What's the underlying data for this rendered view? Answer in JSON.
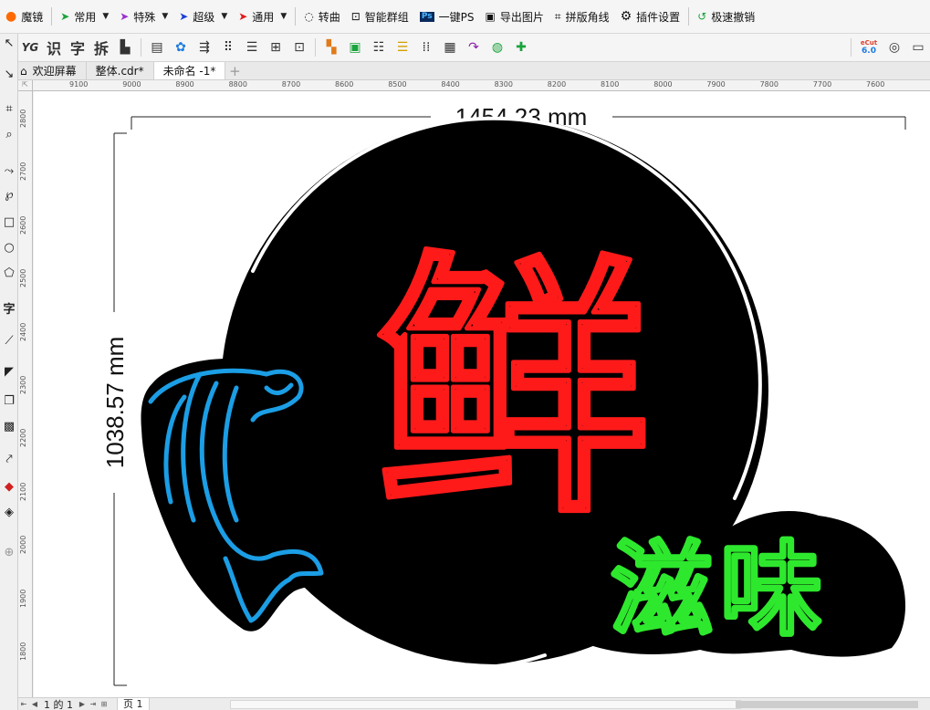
{
  "menubar": {
    "items": [
      {
        "label": "魔镜",
        "icon": "mojing-logo-icon",
        "dropdown": false
      },
      {
        "label": "常用",
        "icon": "green-arrow-icon",
        "dropdown": true
      },
      {
        "label": "特殊",
        "icon": "purple-arrow-icon",
        "dropdown": true
      },
      {
        "label": "超级",
        "icon": "blue-arrow-icon",
        "dropdown": true
      },
      {
        "label": "通用",
        "icon": "red-arrow-icon",
        "dropdown": true
      },
      {
        "label": "转曲",
        "icon": "convert-curve-icon",
        "dropdown": false
      },
      {
        "label": "智能群组",
        "icon": "smart-group-icon",
        "dropdown": false
      },
      {
        "label": "一键PS",
        "icon": "ps-icon",
        "dropdown": false
      },
      {
        "label": "导出图片",
        "icon": "image-export-icon",
        "dropdown": false
      },
      {
        "label": "拼版角线",
        "icon": "crop-marks-icon",
        "dropdown": false
      },
      {
        "label": "插件设置",
        "icon": "gear-icon",
        "dropdown": false
      },
      {
        "label": "极速撤销",
        "icon": "undo-icon",
        "dropdown": false
      }
    ]
  },
  "toolbar": {
    "text_tools": [
      "YG",
      "识",
      "字",
      "拆"
    ],
    "badge": "6.0"
  },
  "tabs": [
    {
      "label": "欢迎屏幕",
      "active": false
    },
    {
      "label": "整体.cdr*",
      "active": false
    },
    {
      "label": "未命名 -1*",
      "active": true
    }
  ],
  "ruler": {
    "h_labels": [
      "9100",
      "9000",
      "8900",
      "8800",
      "8700",
      "8600",
      "8500",
      "8400",
      "8300",
      "8200",
      "8100",
      "8000",
      "7900",
      "7800",
      "7700",
      "7600"
    ],
    "v_labels": [
      "2800",
      "2700",
      "2600",
      "2500",
      "2400",
      "2300",
      "2200",
      "2100",
      "2000",
      "1900",
      "1800"
    ]
  },
  "canvas": {
    "width_dim": "1454.23 mm",
    "height_dim": "1038.57 mm",
    "main_char": "鲜",
    "sub_text": "滋味",
    "colors": {
      "background": "#000000",
      "neon_red": "#ff1a1a",
      "neon_blue": "#1b9ee5",
      "neon_green": "#2ee82e",
      "ring": "#ffffff"
    }
  },
  "status": {
    "page_of": "1 的 1",
    "page_tab": "页 1"
  }
}
